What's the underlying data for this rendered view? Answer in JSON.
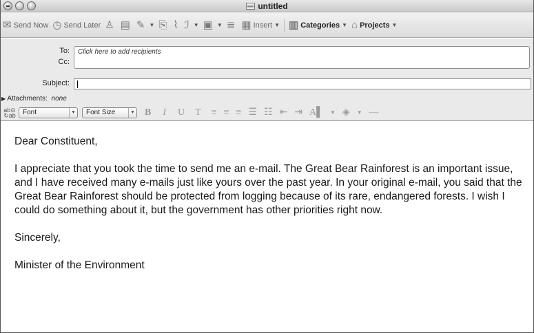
{
  "window": {
    "title": "untitled"
  },
  "toolbar": {
    "send_now": "Send Now",
    "send_later": "Send Later",
    "insert": "Insert",
    "categories": "Categories",
    "projects": "Projects"
  },
  "header": {
    "to_label": "To:",
    "to_placeholder": "Click here to add recipients",
    "cc_label": "Cc:",
    "subject_label": "Subject:",
    "subject_value": "",
    "attachments_label": "Attachments:",
    "attachments_value": "none"
  },
  "format_bar": {
    "font": "Font",
    "font_size": "Font Size",
    "bold": "B",
    "italic": "I",
    "underline": "U",
    "strike": "T"
  },
  "message": {
    "greeting": "Dear Constituent,",
    "paragraph": "I appreciate that you took the time to send me an e-mail. The Great Bear Rainforest is an important issue, and I have received many e-mails just like yours over the past year. In your original e-mail, you said that the Great Bear Rainforest should be protected from logging because of its rare, endangered forests. I wish I could do something about it, but the government has other priorities right now.",
    "closing": "Sincerely,",
    "signature": "Minister of the Environment"
  }
}
